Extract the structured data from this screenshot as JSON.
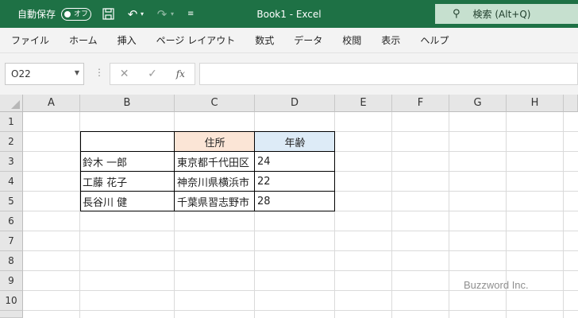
{
  "titlebar": {
    "autosave_label": "自動保存",
    "autosave_state": "オフ",
    "qat_icons": [
      "save-icon",
      "undo-icon",
      "redo-icon",
      "customize-icon"
    ],
    "title": "Book1  -  Excel",
    "search_label": "検索 (Alt+Q)",
    "colors": {
      "title_bg": "#1e7145",
      "search_bg": "#c6e0cf"
    }
  },
  "ribbon": {
    "tabs": [
      "ファイル",
      "ホーム",
      "挿入",
      "ページ レイアウト",
      "数式",
      "データ",
      "校閲",
      "表示",
      "ヘルプ"
    ]
  },
  "formula_bar": {
    "name_box": "O22",
    "formula": "",
    "cancel_icon": "✕",
    "enter_icon": "✓",
    "fx_label": "fx"
  },
  "sheet": {
    "columns": [
      "A",
      "B",
      "C",
      "D",
      "E",
      "F",
      "G",
      "H"
    ],
    "rows": [
      "1",
      "2",
      "3",
      "4",
      "5",
      "6",
      "7",
      "8",
      "9",
      "10"
    ],
    "table": {
      "header": [
        "",
        "住所",
        "年齢"
      ],
      "rows": [
        [
          "鈴木 一郎",
          "東京都千代田区",
          "24"
        ],
        [
          "工藤 花子",
          "神奈川県横浜市",
          "22"
        ],
        [
          "長谷川 健",
          "千葉県習志野市",
          "28"
        ]
      ],
      "colors": {
        "header_c_bg": "#fbe5d6",
        "header_d_bg": "#ddebf7"
      }
    }
  },
  "watermark": "Buzzword Inc."
}
